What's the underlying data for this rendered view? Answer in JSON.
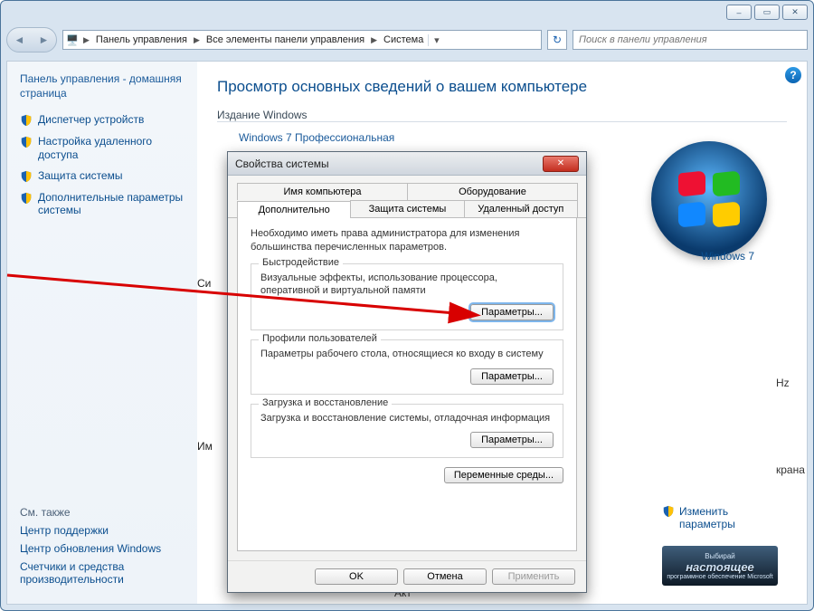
{
  "titlebar": {
    "min": "–",
    "max": "▭",
    "close": "✕"
  },
  "breadcrumb": {
    "icon": "🖥️",
    "segs": [
      "Панель управления",
      "Все элементы панели управления",
      "Система"
    ]
  },
  "search": {
    "placeholder": "Поиск в панели управления"
  },
  "sidebar": {
    "home_title": "Панель управления - домашняя страница",
    "links": [
      "Диспетчер устройств",
      "Настройка удаленного доступа",
      "Защита системы",
      "Дополнительные параметры системы"
    ],
    "see_also_hdr": "См. также",
    "see_also": [
      "Центр поддержки",
      "Центр обновления Windows",
      "Счетчики и средства производительности"
    ]
  },
  "content": {
    "heading": "Просмотр основных сведений о вашем компьютере",
    "group_edition": "Издание Windows",
    "edition": "Windows 7 Профессиональная",
    "brand_win7": "Windows 7",
    "si_label": "Си",
    "im_label": "Им",
    "akt_label": "Акт",
    "hz_peek": "Hz",
    "screen_peek": "крана",
    "change_link": "Изменить параметры",
    "genuine_top": "Выбирай",
    "genuine_mid": "настоящее",
    "genuine_bot": "программное обеспечение Microsoft"
  },
  "dialog": {
    "title": "Свойства системы",
    "tabs_row1": [
      "Имя компьютера",
      "Оборудование"
    ],
    "tabs_row2": [
      "Дополнительно",
      "Защита системы",
      "Удаленный доступ"
    ],
    "active_tab": "Дополнительно",
    "intro": "Необходимо иметь права администратора для изменения большинства перечисленных параметров.",
    "grp1_legend": "Быстродействие",
    "grp1_desc": "Визуальные эффекты, использование процессора, оперативной и виртуальной памяти",
    "grp2_legend": "Профили пользователей",
    "grp2_desc": "Параметры рабочего стола, относящиеся ко входу в систему",
    "grp3_legend": "Загрузка и восстановление",
    "grp3_desc": "Загрузка и восстановление системы, отладочная информация",
    "btn_params": "Параметры...",
    "btn_env": "Переменные среды...",
    "btn_ok": "OK",
    "btn_cancel": "Отмена",
    "btn_apply": "Применить"
  }
}
